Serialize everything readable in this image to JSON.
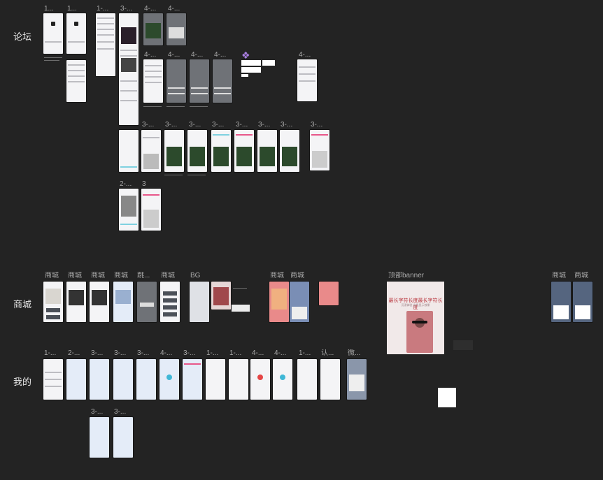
{
  "sections": {
    "forum": "论坛",
    "mall": "商城",
    "mine": "我的"
  },
  "forum_labels": [
    "1...",
    "1...",
    "1-...",
    "3-...",
    "4-...",
    "4-...",
    "4-...",
    "4-...",
    "4-...",
    "4-...",
    "4-...",
    "3-...",
    "3-...",
    "3-...",
    "3-...",
    "3-...",
    "3-...",
    "3-...",
    "3-...",
    "2-...",
    "3"
  ],
  "mall_labels": [
    "商城",
    "商城",
    "商城",
    "商城",
    "跳...",
    "商城",
    "BG",
    "商城",
    "商城",
    "顶部banner",
    "商城",
    "商城"
  ],
  "mine_labels": [
    "1-...",
    "2-...",
    "3-...",
    "3-...",
    "3-...",
    "4-...",
    "3-...",
    "1-...",
    "1-...",
    "4-...",
    "4-...",
    "1-...",
    "认...",
    "微...",
    "3-...",
    "3-..."
  ],
  "banner": {
    "title": "最长字符长度最长字符长度",
    "subtitle": "沉浸体验 出色显示效果"
  },
  "colors": {
    "canvas": "#232323",
    "frame": "#f4f4f6",
    "accent": "#a97fe0"
  }
}
